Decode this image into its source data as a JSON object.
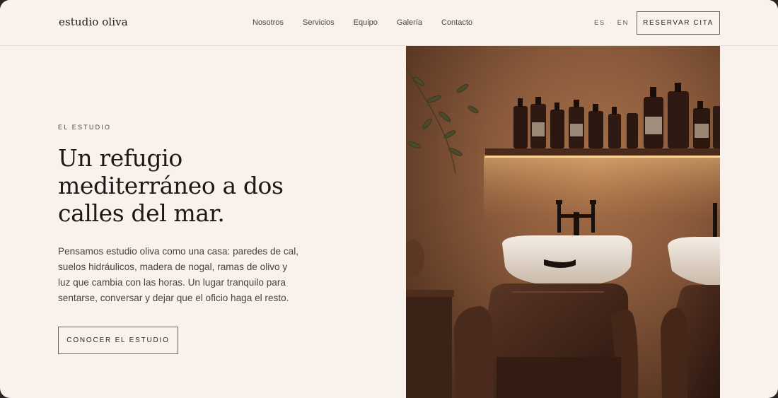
{
  "brand": {
    "logo_text": "estudio oliva"
  },
  "nav": {
    "items": [
      {
        "label": "Nosotros"
      },
      {
        "label": "Servicios"
      },
      {
        "label": "Equipo"
      },
      {
        "label": "Galería"
      },
      {
        "label": "Contacto"
      }
    ]
  },
  "language": {
    "es": "ES",
    "separator": "·",
    "en": "EN"
  },
  "header": {
    "book_label": "RESERVAR CITA"
  },
  "hero": {
    "eyebrow": "EL ESTUDIO",
    "headline": "Un refugio mediterráneo a dos calles del mar.",
    "body": "Pensamos estudio oliva como una casa: paredes de cal, suelos hidráulicos, madera de nogal, ramas de olivo y luz que cambia con las horas. Un lugar tranquilo para sentarse, conversar y dejar que el oficio haga el resto.",
    "cta_label": "CONOCER EL ESTUDIO"
  },
  "colors": {
    "background": "#f8f1ec",
    "text": "#1d1917",
    "border": "#6b625c",
    "wall": "#8a5a38",
    "leather": "#3d2419"
  }
}
